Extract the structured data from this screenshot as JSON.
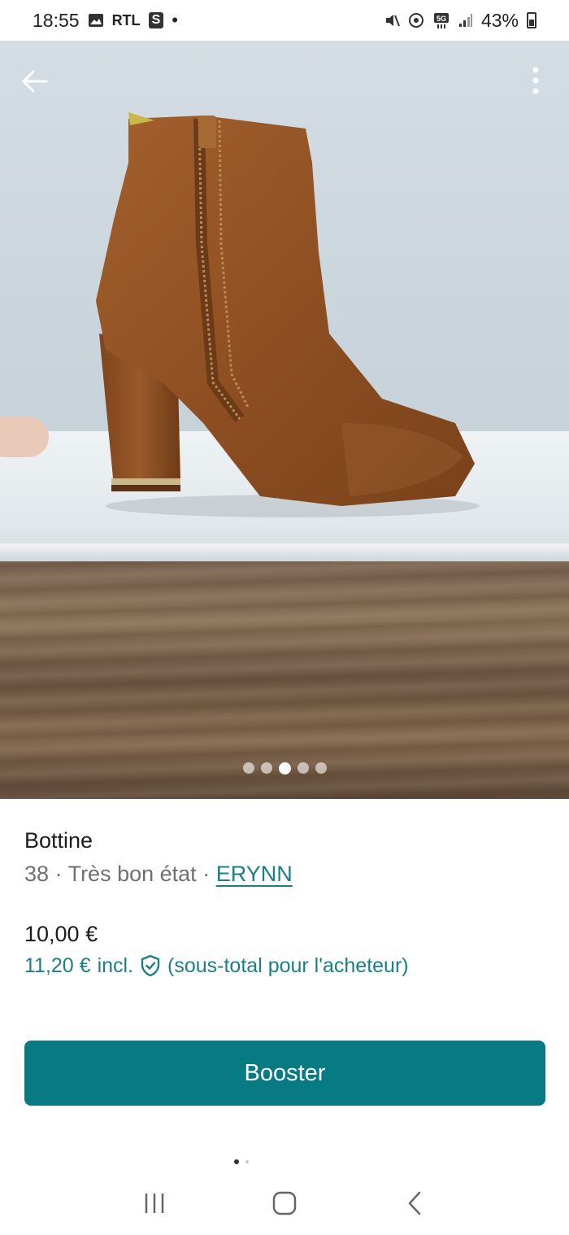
{
  "status_bar": {
    "time": "18:55",
    "left_icons": [
      "gallery-icon",
      "rtl-app-icon",
      "s-app-icon",
      "notification-dot-icon"
    ],
    "rtl_label": "RTL",
    "s_label": "S",
    "right_icons": [
      "mute-icon",
      "hotspot-icon",
      "5g-icon",
      "signal-icon"
    ],
    "battery": "43%"
  },
  "photo": {
    "pages": 5,
    "active_page": 3
  },
  "item": {
    "title": "Bottine",
    "size": "38",
    "condition": "Très bon état",
    "separator": "·",
    "brand": "ERYNN",
    "price": "10,00 €",
    "price_incl": "11,20 €",
    "incl_label": "incl.",
    "incl_note": "(sous-total pour l'acheteur)"
  },
  "actions": {
    "booster_label": "Booster"
  },
  "colors": {
    "accent": "#077a84",
    "link": "#1a7f88"
  }
}
